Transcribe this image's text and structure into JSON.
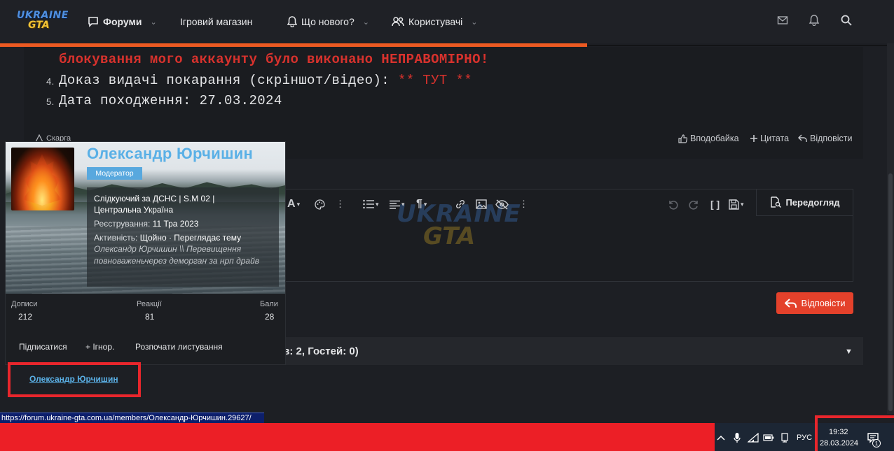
{
  "nav": {
    "logo_line1": "UKRAINE",
    "logo_line2": "GTA",
    "items": [
      {
        "label": "Форуми",
        "icon": "chat-icon",
        "has_dropdown": true,
        "bold": true
      },
      {
        "label": "Ігровий магазин",
        "has_dropdown": false
      },
      {
        "label": "Що нового?",
        "icon": "bell-icon",
        "has_dropdown": true
      },
      {
        "label": "Користувачі",
        "icon": "users-icon",
        "has_dropdown": true
      }
    ],
    "right_icons": [
      "mail-icon",
      "bell-icon",
      "search-icon"
    ]
  },
  "post": {
    "line_red": "блокування мого аккаунту було виконано НЕПРАВОМІРНО!",
    "item4": {
      "num": "4.",
      "text": "Доказ видачі покарання (скріншот/відео): ",
      "highlight": "** ТУТ **"
    },
    "item5": {
      "num": "5.",
      "text": "Дата походження: 27.03.2024"
    },
    "report_label": "Скарга",
    "actions": [
      {
        "label": "Вподобайка",
        "icon": "thumbs-up-icon"
      },
      {
        "label": "Цитата",
        "icon": "plus-icon"
      },
      {
        "label": "Відповісти",
        "icon": "reply-icon"
      }
    ]
  },
  "editor": {
    "preview_label": "Передогляд",
    "watermark_line1": "UKRAINE",
    "watermark_line2": "GTA",
    "reply_label": "Відповісти"
  },
  "online": {
    "text": "ів: 2, Гостей: 0)"
  },
  "member_card": {
    "name": "Олександр Юрчишин",
    "role": "Модератор",
    "title_line1": "Слідкуючий за ДСНС | S.M 02 |",
    "title_line2": "Центральна Україна",
    "registered_label": "Реєстрування:",
    "registered_value": "11 Тра 2023",
    "activity_label": "Активність:",
    "activity_value": "Щойно · Переглядає тему",
    "activity_topic": "Олександр Юрчишин \\\\ Перевищення повноваженьчерез деморган за нрп драйв",
    "stats": [
      {
        "label": "Дописи",
        "value": "212"
      },
      {
        "label": "Реакції",
        "value": "81"
      },
      {
        "label": "Бали",
        "value": "28"
      }
    ],
    "actions": [
      "Підписатися",
      "+ Ігнор.",
      "Розпочати листування"
    ]
  },
  "username_link": "Олександр Юрчишин",
  "status_url": "https://forum.ukraine-gta.com.ua/members/Олександр-Юрчишин.29627/",
  "taskbar": {
    "lang": "РУС",
    "time": "19:32",
    "date": "28.03.2024",
    "notification_count": "1"
  }
}
